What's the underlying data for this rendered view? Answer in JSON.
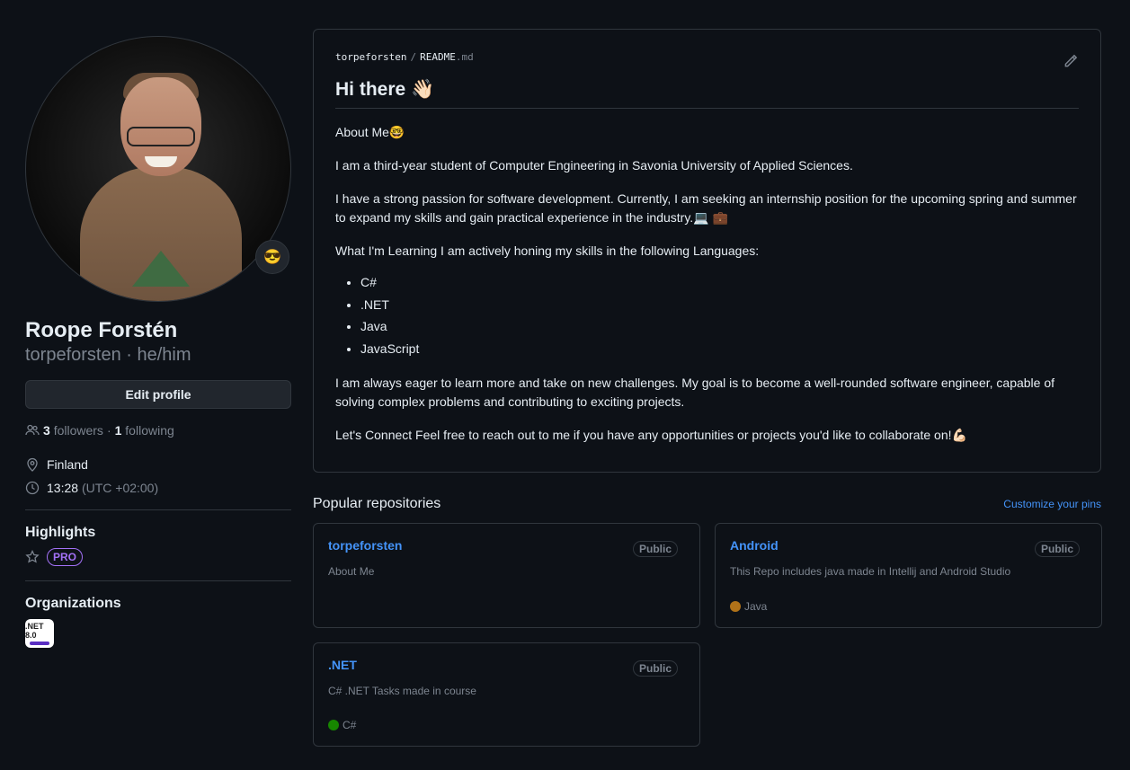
{
  "profile": {
    "status_emoji": "😎",
    "name": "Roope Forstén",
    "login_line": "torpeforsten · he/him",
    "edit_button": "Edit profile",
    "followers_count": "3",
    "followers_label": "followers",
    "separator": "·",
    "following_count": "1",
    "following_label": "following",
    "location": "Finland",
    "time": "13:28",
    "timezone": "(UTC +02:00)"
  },
  "highlights": {
    "title": "Highlights",
    "badge": "PRO"
  },
  "organizations": {
    "title": "Organizations",
    "logo_text": ".NET 8.0"
  },
  "readme": {
    "path_user": "torpeforsten",
    "path_sep": "/",
    "path_file": "README",
    "path_ext": ".md",
    "heading": "Hi there 👋🏻",
    "p1": "About Me🤓",
    "p2": "I am a third-year student of Computer Engineering in Savonia University of Applied Sciences.",
    "p3": "I have a strong passion for software development. Currently, I am seeking an internship position for the upcoming spring and summer to expand my skills and gain practical experience in the industry.💻 💼",
    "p4": "What I'm Learning I am actively honing my skills in the following Languages:",
    "languages": [
      "C#",
      ".NET",
      "Java",
      "JavaScript"
    ],
    "p5": "I am always eager to learn more and take on new challenges. My goal is to become a well-rounded software engineer, capable of solving complex problems and contributing to exciting projects.",
    "p6": "Let's Connect Feel free to reach out to me if you have any opportunities or projects you'd like to collaborate on!💪🏻"
  },
  "popular": {
    "title": "Popular repositories",
    "customize": "Customize your pins",
    "repos": [
      {
        "name": "torpeforsten",
        "visibility": "Public",
        "description": "About Me",
        "language": "",
        "color": ""
      },
      {
        "name": "Android",
        "visibility": "Public",
        "description": "This Repo includes java made in Intellij and Android Studio",
        "language": "Java",
        "color": "#b07219"
      },
      {
        "name": ".NET",
        "visibility": "Public",
        "description": "C# .NET Tasks made in course",
        "language": "C#",
        "color": "#178600"
      }
    ]
  },
  "icons": {
    "people": "people-icon",
    "location": "location-icon",
    "clock": "clock-icon",
    "star": "star-icon",
    "pencil": "pencil-icon"
  },
  "colors": {
    "background": "#0d1117",
    "link": "#4493f8",
    "border": "#30363d",
    "muted": "#7d8590",
    "pro": "#a371f7"
  }
}
